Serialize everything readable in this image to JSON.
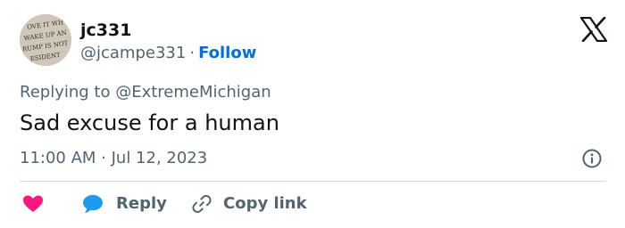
{
  "author": {
    "display_name": "jc331",
    "handle": "@jcampe331",
    "separator": "·",
    "follow_label": "Follow",
    "avatar_text": "LOVE IT WHEN I WAKE UP AND TRUMP IS NOT PRESIDENT"
  },
  "reply_context": {
    "prefix": "Replying to ",
    "mention": "@ExtremeMichigan"
  },
  "tweet": {
    "text": "Sad excuse for a human",
    "timestamp": "11:00 AM · Jul 12, 2023"
  },
  "actions": {
    "like_icon": "heart-icon",
    "reply_label": "Reply",
    "copy_link_label": "Copy link"
  },
  "icons": {
    "logo": "x-logo-icon",
    "info": "info-icon",
    "reply": "speech-bubble-icon",
    "copy": "link-icon"
  },
  "colors": {
    "accent": "#006fd6",
    "like": "#f91880",
    "reply_bubble": "#1d9bf0",
    "secondary_text": "#536471",
    "primary_text": "#0f1419"
  }
}
